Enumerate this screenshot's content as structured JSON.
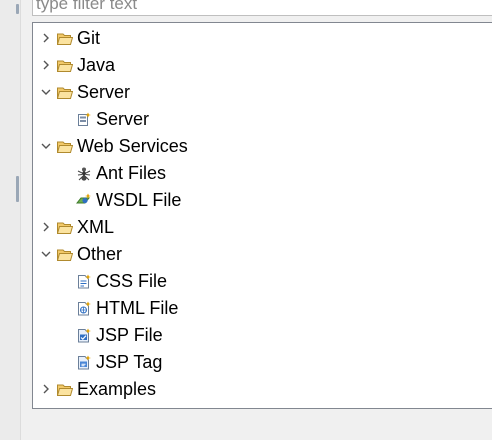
{
  "filter": {
    "placeholder": "type filter text",
    "value": ""
  },
  "tree": [
    {
      "label": "Git",
      "level": 0,
      "kind": "folder",
      "expanded": false,
      "icon": "folder-icon"
    },
    {
      "label": "Java",
      "level": 0,
      "kind": "folder",
      "expanded": false,
      "icon": "folder-icon"
    },
    {
      "label": "Server",
      "level": 0,
      "kind": "folder",
      "expanded": true,
      "icon": "folder-icon"
    },
    {
      "label": "Server",
      "level": 1,
      "kind": "item",
      "icon": "server-wizard-icon"
    },
    {
      "label": "Web Services",
      "level": 0,
      "kind": "folder",
      "expanded": true,
      "icon": "folder-icon"
    },
    {
      "label": "Ant Files",
      "level": 1,
      "kind": "item",
      "icon": "ant-icon"
    },
    {
      "label": "WSDL File",
      "level": 1,
      "kind": "item",
      "icon": "wsdl-file-icon"
    },
    {
      "label": "XML",
      "level": 0,
      "kind": "folder",
      "expanded": false,
      "icon": "folder-icon"
    },
    {
      "label": "Other",
      "level": 0,
      "kind": "folder",
      "expanded": true,
      "icon": "folder-icon"
    },
    {
      "label": "CSS File",
      "level": 1,
      "kind": "item",
      "icon": "css-file-icon"
    },
    {
      "label": "HTML File",
      "level": 1,
      "kind": "item",
      "icon": "html-file-icon"
    },
    {
      "label": "JSP File",
      "level": 1,
      "kind": "item",
      "icon": "jsp-file-icon"
    },
    {
      "label": "JSP Tag",
      "level": 1,
      "kind": "item",
      "icon": "jsp-tag-icon"
    },
    {
      "label": "Examples",
      "level": 0,
      "kind": "folder",
      "expanded": false,
      "icon": "folder-icon"
    }
  ],
  "colors": {
    "tree_border": "#828790",
    "folder_fill": "#f2c969",
    "folder_stroke": "#b08a2e",
    "page_fill": "#ffffff",
    "page_stroke": "#6b7f99",
    "accent_blue": "#2f6fc3",
    "accent_gold": "#e0a000",
    "arrow": "#555555"
  }
}
